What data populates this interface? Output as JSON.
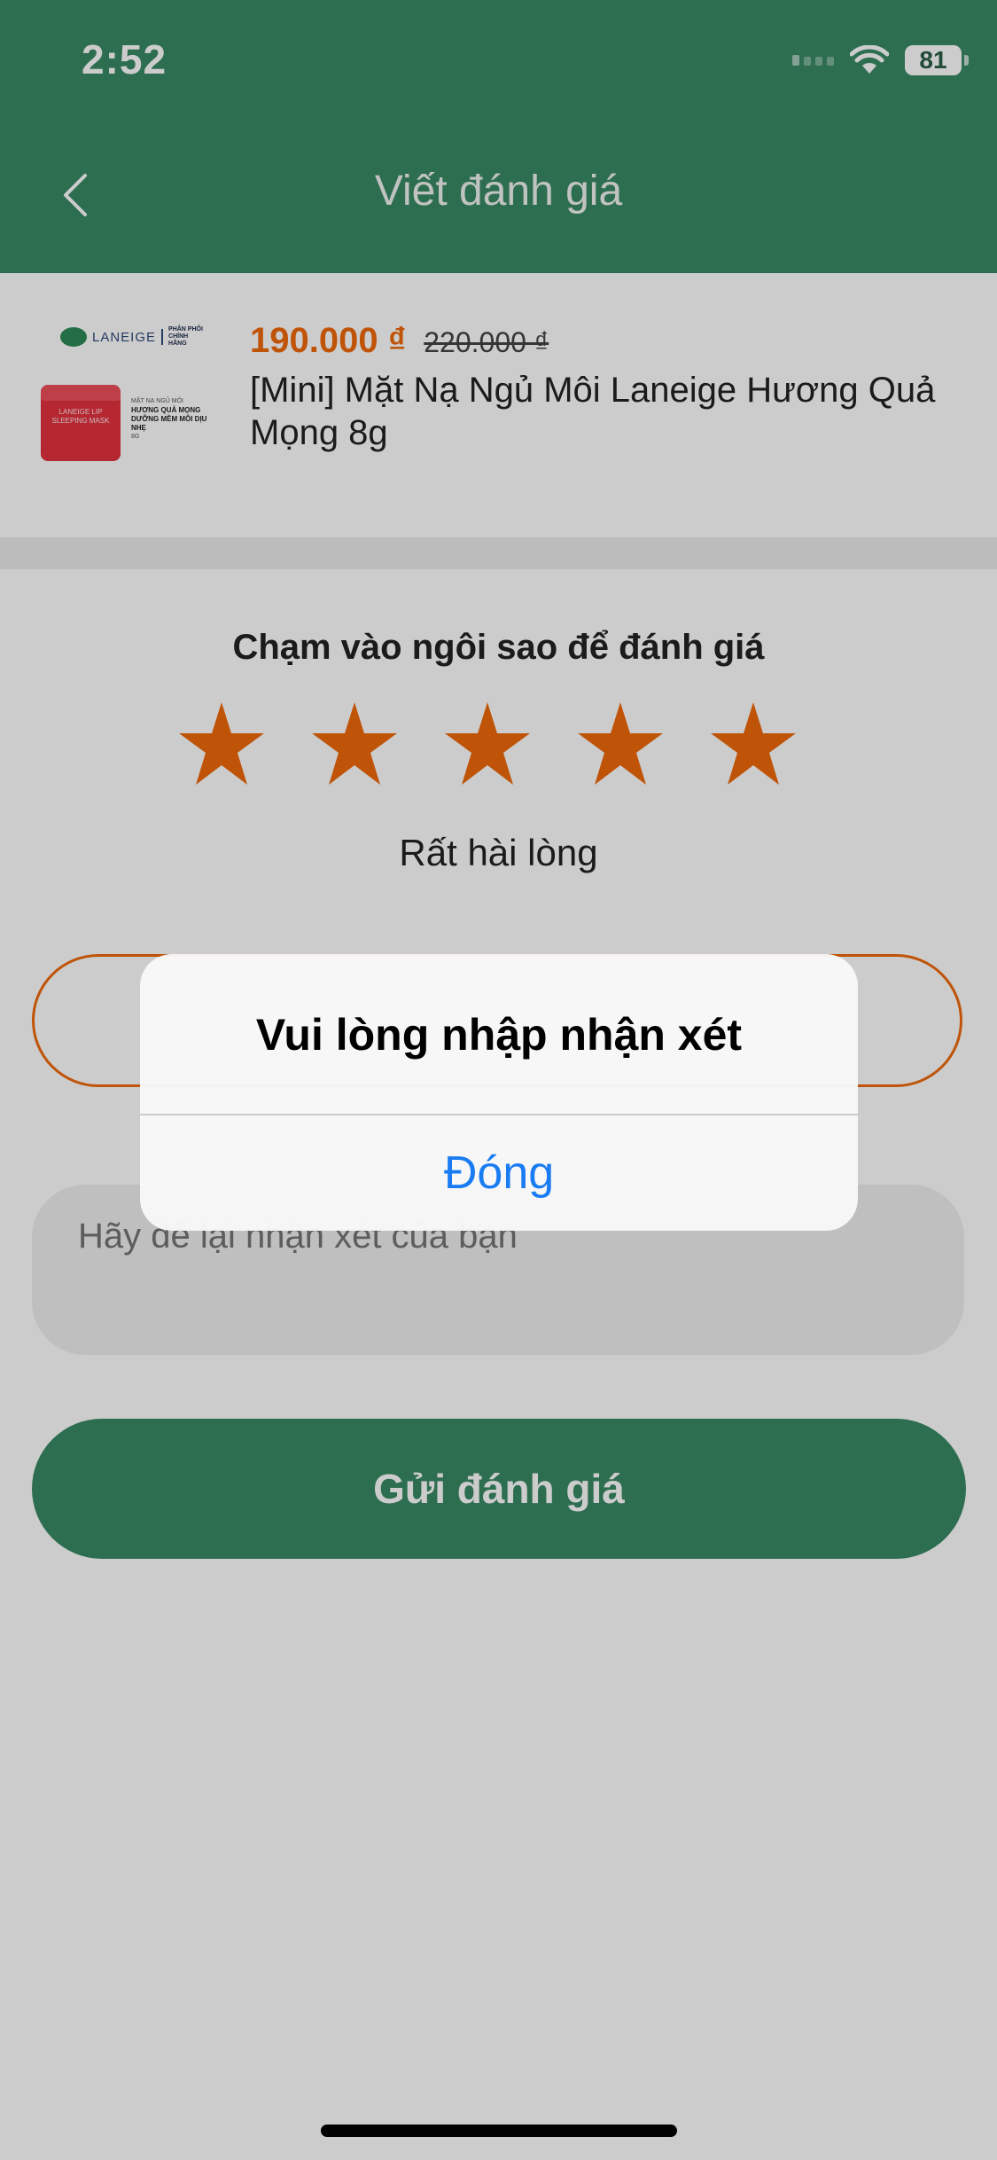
{
  "status_bar": {
    "time": "2:52",
    "battery": "81"
  },
  "header": {
    "title": "Viết đánh giá",
    "back_icon": "chevron-left-icon",
    "color": "#3a8a64"
  },
  "product": {
    "price": "190.000 ₫",
    "old_price": "220.000 ₫",
    "name": "[Mini] Mặt Nạ Ngủ Môi Laneige Hương Quả Mọng 8g",
    "thumbnail": {
      "brand": "LANEIGE",
      "distributor": "PHÂN PHỐI CHÍNH HÃNG",
      "jar_label": "LANEIGE LIP SLEEPING MASK",
      "desc_line1": "MẶT NẠ NGỦ MÔI",
      "desc_line2": "HƯƠNG QUẢ MỌNG DƯỠNG MỀM MÔI DỊU NHẸ",
      "desc_line3": "8G"
    },
    "price_color": "#ef6a0a"
  },
  "rating": {
    "prompt": "Chạm vào ngôi sao để đánh giá",
    "stars_filled": 5,
    "stars_total": 5,
    "label": "Rất hài lòng",
    "star_color": "#ef6a0a"
  },
  "comment": {
    "placeholder": "Hãy để lại nhận xét của bạn"
  },
  "submit": {
    "label": "Gửi đánh giá"
  },
  "alert": {
    "title": "Vui lòng nhập nhận xét",
    "button": "Đóng",
    "button_color": "#1a7cf2"
  }
}
